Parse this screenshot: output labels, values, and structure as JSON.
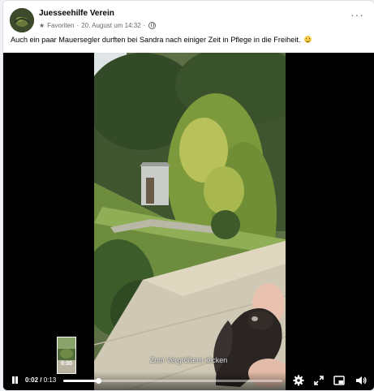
{
  "post": {
    "author": "Juesseehilfe Verein",
    "favorites_label": "Favoriten",
    "separator": "·",
    "timestamp": "20. August um 14:32",
    "separator2": "·",
    "more_label": "···",
    "text": "Auch ein paar Mauersegler durften bei Sandra nach einiger Zeit in Pflege in die Freiheit.",
    "emoji_icon": "smiling-face-icon"
  },
  "video": {
    "hover_hint": "Zum Vergrößern klicken",
    "thumbnail_time": "0:00",
    "current_time": "0:02",
    "time_separator": " / ",
    "total_time": "0:13",
    "progress": 0.16,
    "icons": [
      "pause-icon",
      "settings-icon",
      "expand-icon",
      "pip-icon",
      "volume-icon"
    ]
  },
  "colors": {
    "background": "#f0f2f5",
    "card": "#ffffff",
    "text_primary": "#050505",
    "text_secondary": "#65676b",
    "video_bg": "#000000"
  }
}
